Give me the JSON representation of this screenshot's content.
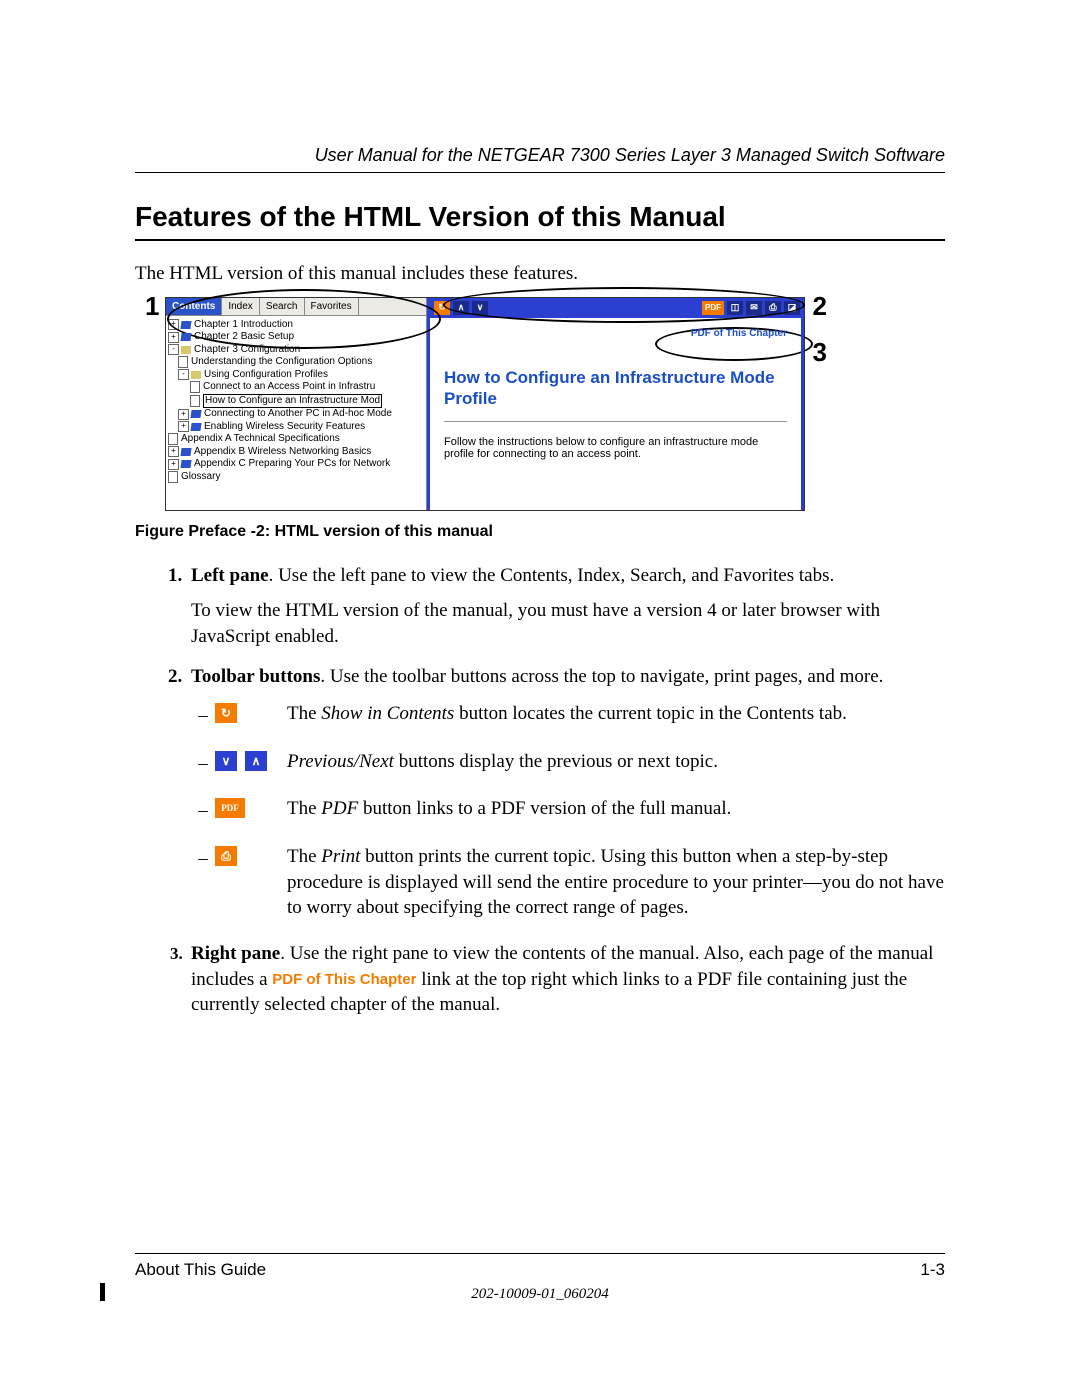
{
  "header": {
    "running_head": "User Manual for the NETGEAR 7300 Series Layer 3 Managed Switch Software"
  },
  "title": "Features of the HTML Version of this Manual",
  "intro": "The HTML version of this manual includes these features.",
  "callouts": {
    "c1": "1",
    "c2": "2",
    "c3": "3"
  },
  "figure": {
    "tabs": {
      "contents": "Contents",
      "index": "Index",
      "search": "Search",
      "favorites": "Favorites"
    },
    "tree": [
      "Chapter 1  Introduction",
      "Chapter 2  Basic Setup",
      "Chapter 3  Configuration",
      "Understanding the Configuration Options",
      "Using Configuration Profiles",
      "Connect to an Access Point in Infrastru",
      "How to Configure an Infrastructure Mod",
      "Connecting to Another PC in Ad-hoc Mode",
      "Enabling Wireless Security Features",
      "Appendix A  Technical Specifications",
      "Appendix B  Wireless Networking Basics",
      "Appendix C  Preparing Your PCs for Network",
      "Glossary"
    ],
    "toolbar": {
      "pdf": "PDF"
    },
    "right": {
      "pdf_chapter": "PDF of This Chapter",
      "title": "How to Configure an Infrastructure Mode Profile",
      "body": "Follow the instructions below to configure an infrastructure mode profile for connecting to an access point."
    },
    "caption": "Figure Preface -2:  HTML version of this manual"
  },
  "list": {
    "item1_lead": "Left pane",
    "item1_body": ". Use the left pane to view the Contents, Index, Search, and Favorites tabs.",
    "item1_sub": "To view the HTML version of the manual, you must have a version 4 or later browser with JavaScript enabled.",
    "item2_lead": "Toolbar buttons",
    "item2_body": ". Use the toolbar buttons across the top to navigate, print pages, and more.",
    "b1_pre": "The ",
    "b1_em": "Show in Contents",
    "b1_post": " button locates the current topic in the Contents tab.",
    "b2_em": "Previous/Next",
    "b2_post": " buttons display the previous or next topic.",
    "b3_pre": "The ",
    "b3_em": "PDF",
    "b3_post": " button links to a PDF version of the full manual.",
    "b4_pre": "The ",
    "b4_em": "Print",
    "b4_post": " button prints the current topic. Using this button when a step-by-step procedure is displayed will send the entire procedure to your printer—you do not have to worry about specifying the correct range of pages.",
    "item3_lead": "Right pane",
    "item3_a": ". Use the right pane to view the contents of the manual. Also, each page of the manual includes a ",
    "item3_link": "PDF of This Chapter",
    "item3_b": " link at the top right which links to a PDF file containing just the currently selected chapter of the manual."
  },
  "footer": {
    "section": "About This Guide",
    "page": "1-3",
    "docnum": "202-10009-01_060204"
  }
}
